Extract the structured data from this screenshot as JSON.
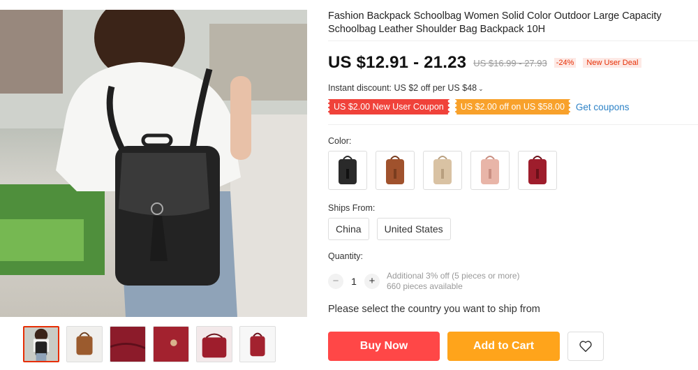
{
  "product": {
    "title": "Fashion Backpack Schoolbag Women Solid Color Outdoor Large Capacity Schoolbag Leather Shoulder Bag Backpack 10H"
  },
  "price": {
    "current": "US $12.91 - 21.23",
    "original": "US $16.99 - 27.93",
    "discount": "-24%",
    "deal_badge": "New User Deal"
  },
  "instant_discount": "Instant discount: US $2 off per US $48",
  "coupons": {
    "items": [
      "US $2.00 New User Coupon",
      "US $2.00 off on US $58.00"
    ],
    "get_label": "Get coupons",
    "colors": [
      "#f0423a",
      "#f8a12b"
    ]
  },
  "color": {
    "label": "Color:",
    "swatches": [
      {
        "icon": "black-backpack",
        "hex": "#2a2a2a"
      },
      {
        "icon": "brown-backpack",
        "hex": "#a0522d"
      },
      {
        "icon": "beige-backpack",
        "hex": "#d9c2a3"
      },
      {
        "icon": "pink-backpack",
        "hex": "#e8b5a8"
      },
      {
        "icon": "red-backpack",
        "hex": "#9e1d2c"
      }
    ]
  },
  "ships_from": {
    "label": "Ships From:",
    "options": [
      "China",
      "United States"
    ]
  },
  "quantity": {
    "label": "Quantity:",
    "value": "1",
    "minus": "−",
    "plus": "+",
    "info_line1": "Additional 3% off (5 pieces or more)",
    "info_line2": "660 pieces available"
  },
  "ship_country_msg": "Please select the country you want to ship from",
  "actions": {
    "buy_now": "Buy Now",
    "add_to_cart": "Add to Cart",
    "wishlist_icon": "heart-icon",
    "buy_color": "#ff4747",
    "cart_color": "#ffa41b"
  },
  "gallery": {
    "thumbnails": [
      "black-backpack-worn",
      "brown-backpack",
      "red-leather-detail",
      "red-leather-closeup",
      "red-bag-open",
      "red-backpack"
    ]
  }
}
